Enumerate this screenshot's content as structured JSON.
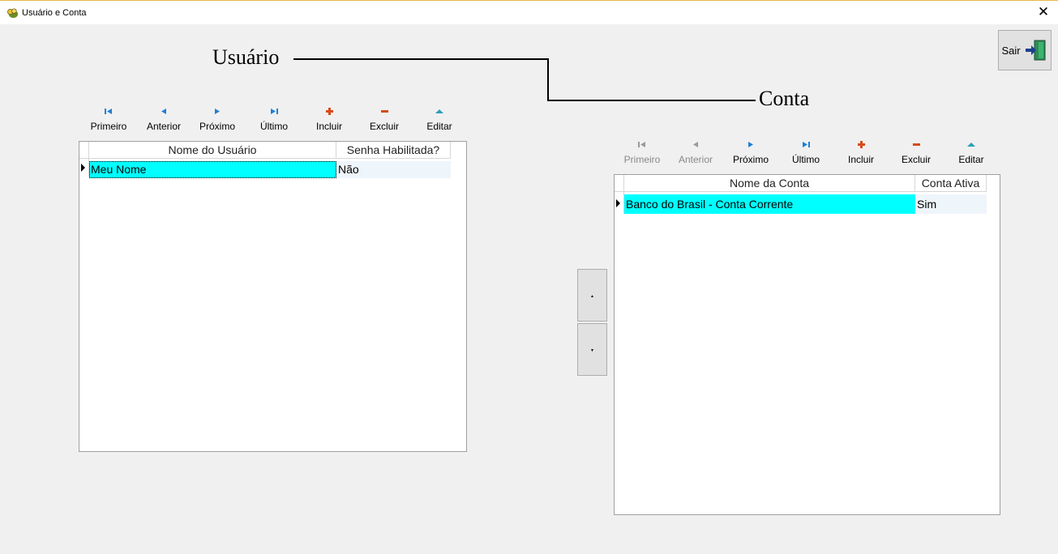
{
  "window": {
    "title": "Usuário e Conta",
    "close_glyph": "✕"
  },
  "labels": {
    "usuario": "Usuário",
    "conta": "Conta"
  },
  "sair": {
    "label": "Sair",
    "icon": "exit-door-icon"
  },
  "usuario_nav": [
    {
      "label": "Primeiro",
      "icon": "first-record-icon",
      "enabled": true
    },
    {
      "label": "Anterior",
      "icon": "prior-record-icon",
      "enabled": true
    },
    {
      "label": "Próximo",
      "icon": "next-record-icon",
      "enabled": true
    },
    {
      "label": "Último",
      "icon": "last-record-icon",
      "enabled": true
    },
    {
      "label": "Incluir",
      "icon": "insert-icon",
      "enabled": true
    },
    {
      "label": "Excluir",
      "icon": "delete-icon",
      "enabled": true
    },
    {
      "label": "Editar",
      "icon": "edit-icon",
      "enabled": true
    }
  ],
  "conta_nav": [
    {
      "label": "Primeiro",
      "icon": "first-record-icon",
      "enabled": false
    },
    {
      "label": "Anterior",
      "icon": "prior-record-icon",
      "enabled": false
    },
    {
      "label": "Próximo",
      "icon": "next-record-icon",
      "enabled": true
    },
    {
      "label": "Último",
      "icon": "last-record-icon",
      "enabled": true
    },
    {
      "label": "Incluir",
      "icon": "insert-icon",
      "enabled": true
    },
    {
      "label": "Excluir",
      "icon": "delete-icon",
      "enabled": true
    },
    {
      "label": "Editar",
      "icon": "edit-icon",
      "enabled": true
    }
  ],
  "usuario_grid": {
    "columns": [
      "Nome do Usuário",
      "Senha Habilitada?"
    ],
    "rows": [
      [
        "Meu Nome",
        "Não"
      ]
    ]
  },
  "conta_grid": {
    "columns": [
      "Nome da Conta",
      "Conta Ativa"
    ],
    "rows": [
      [
        "Banco do Brasil - Conta Corrente",
        "Sim"
      ]
    ]
  },
  "move_buttons": {
    "up_glyph": "▲",
    "down_glyph": "▼"
  },
  "colors": {
    "selected_cell": "#00ffff",
    "alt_cell": "#eef5fb",
    "nav_blue": "#1e7fd6",
    "nav_red": "#d84a1b",
    "nav_teal": "#2a9fb8"
  }
}
